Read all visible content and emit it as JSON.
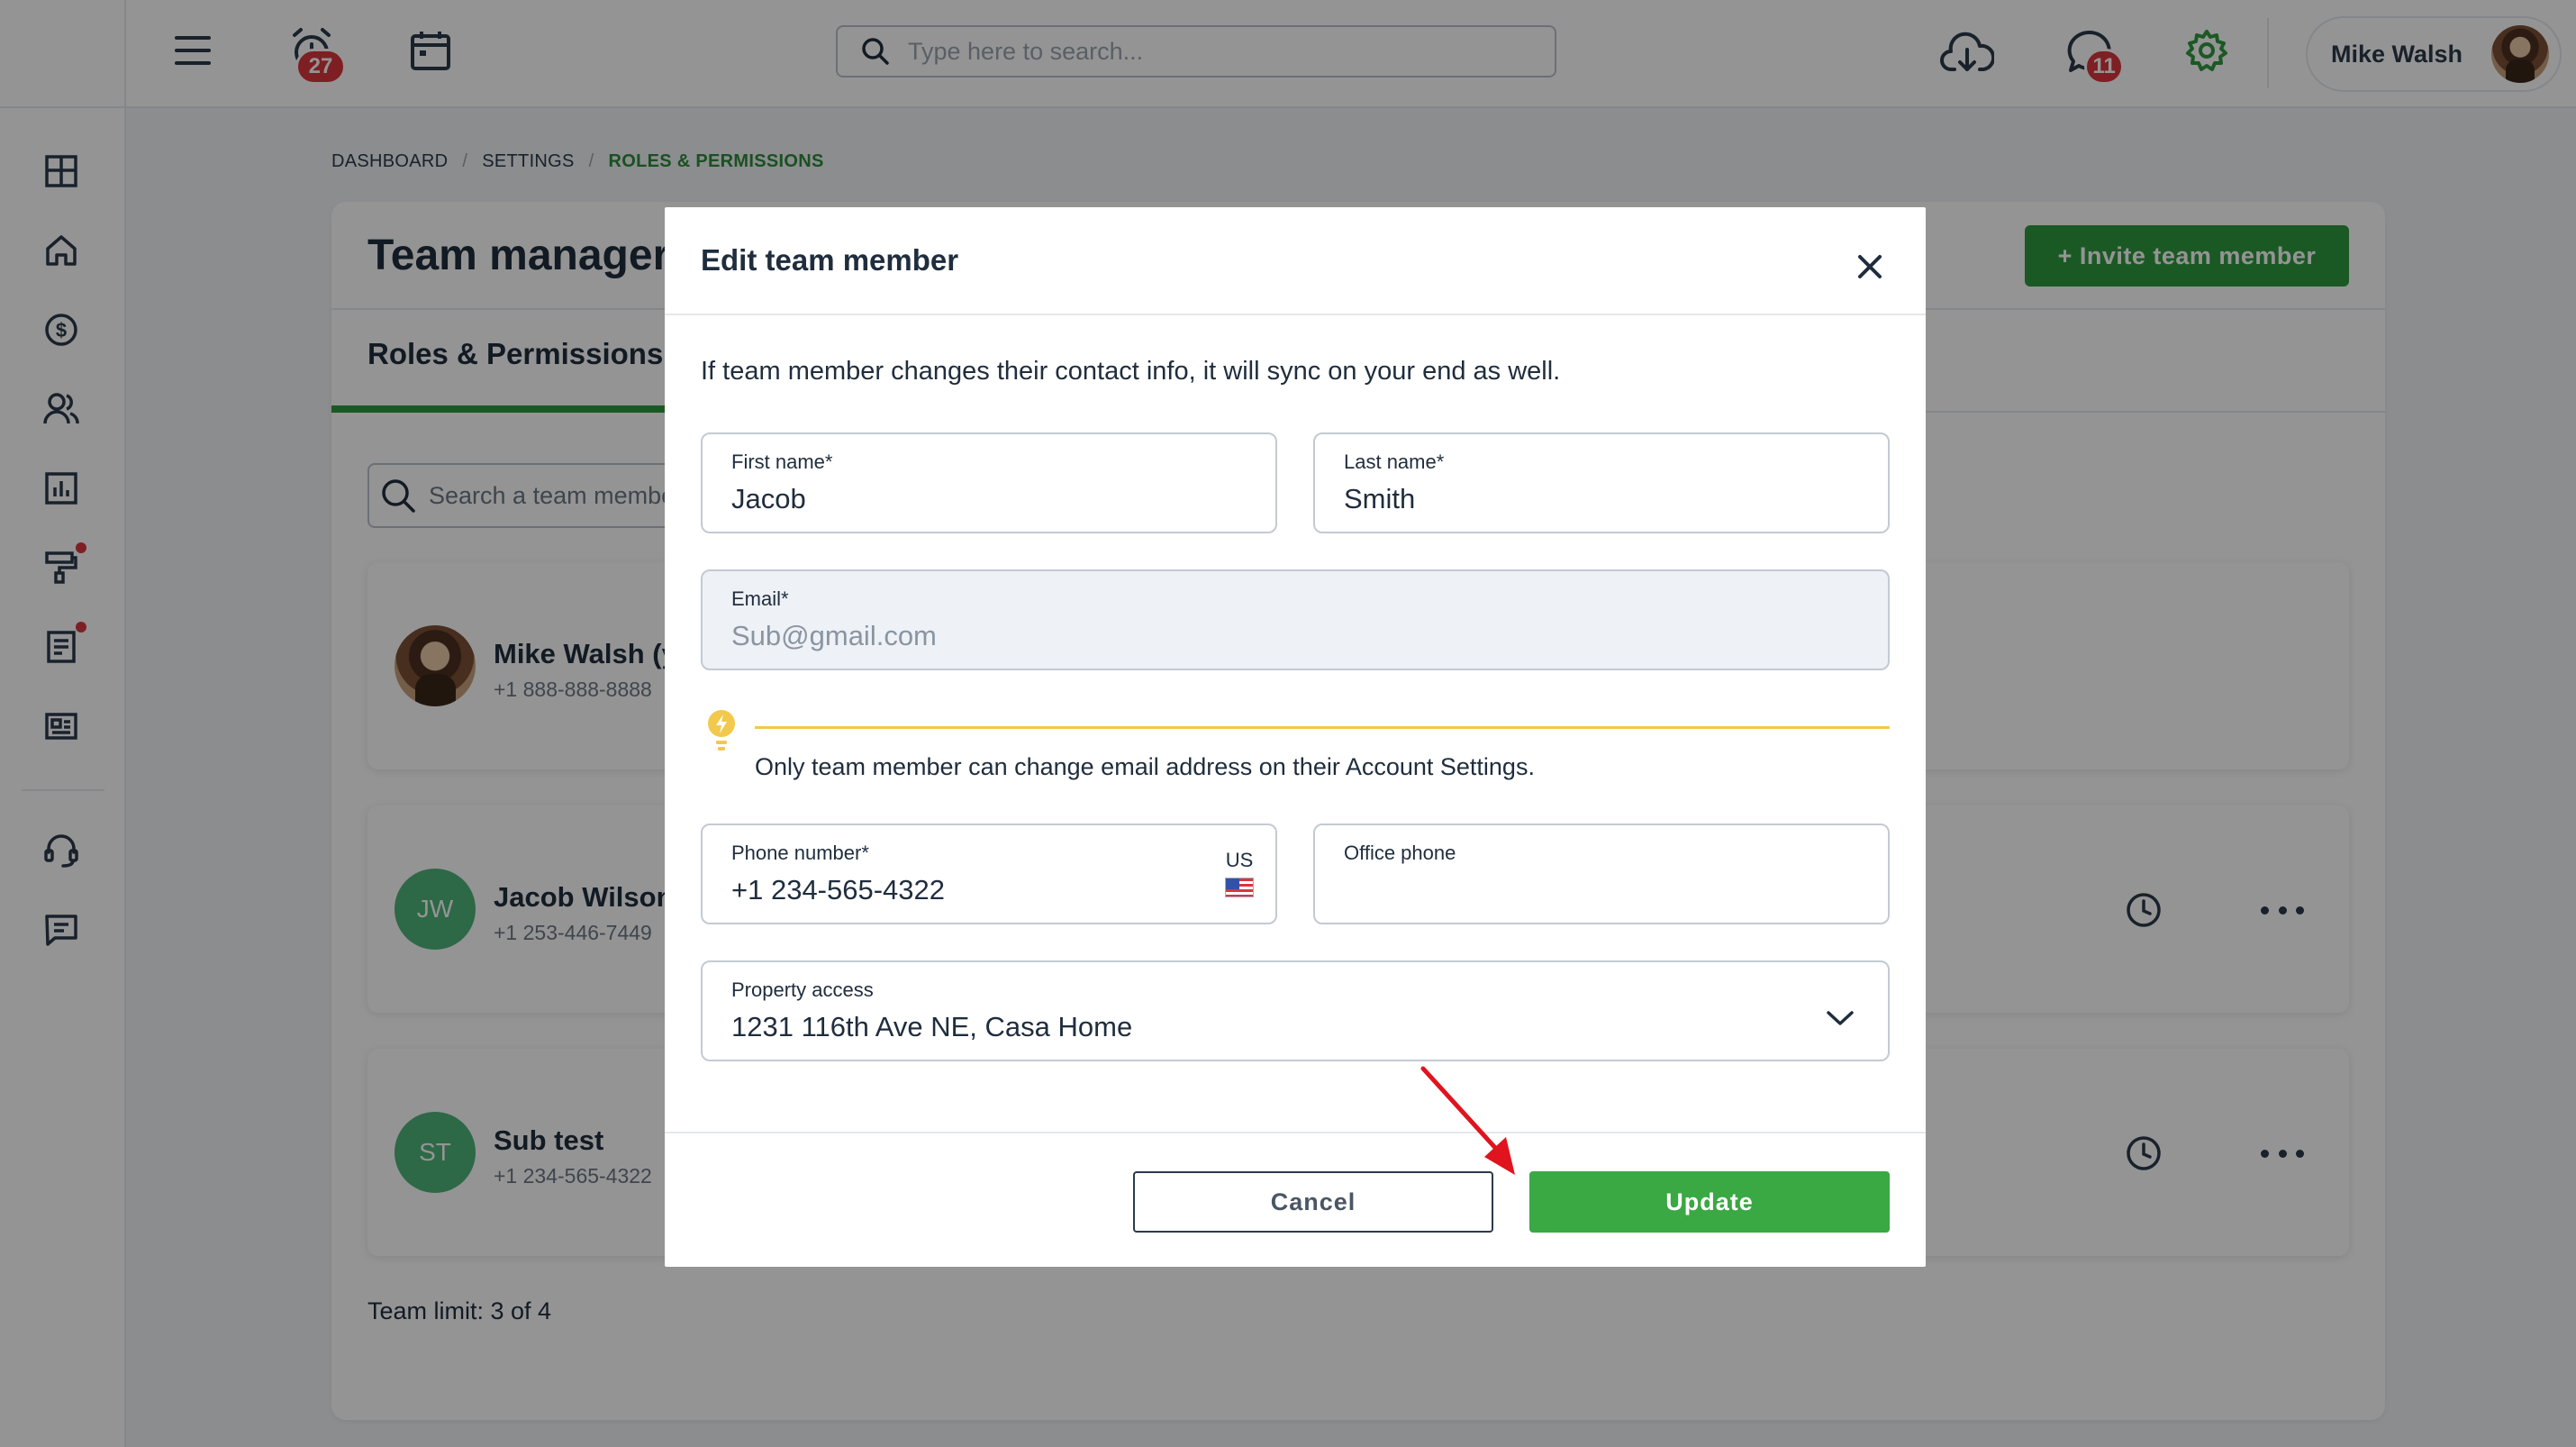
{
  "header": {
    "search_placeholder": "Type here to search...",
    "alarm_badge": "27",
    "chat_badge": "11",
    "user_name": "Mike Walsh"
  },
  "breadcrumb": [
    "DASHBOARD",
    "/",
    "SETTINGS",
    "/",
    "ROLES & PERMISSIONS"
  ],
  "page": {
    "title": "Team manager",
    "invite_label": "+ Invite team member",
    "tab_label": "Roles & Permissions",
    "member_search_placeholder": "Search a team member",
    "team_limit": "Team limit: 3 of 4"
  },
  "members": [
    {
      "name": "Mike Walsh (y",
      "phone": "+1 888-888-8888",
      "initials": ""
    },
    {
      "name": "Jacob Wilson",
      "phone": "+1 253-446-7449",
      "initials": "JW"
    },
    {
      "name": "Sub test",
      "phone": "+1 234-565-4322",
      "initials": "ST"
    }
  ],
  "modal": {
    "title": "Edit team member",
    "note": "If team member changes their contact info, it will sync on your end as well.",
    "first_name_label": "First name*",
    "first_name_value": "Jacob",
    "last_name_label": "Last name*",
    "last_name_value": "Smith",
    "email_label": "Email*",
    "email_value": "Sub@gmail.com",
    "tip_text": "Only team member can change email address on their Account Settings.",
    "phone_label": "Phone number*",
    "phone_value": "+1 234-565-4322",
    "phone_country": "US",
    "office_phone_label": "Office phone",
    "office_phone_value": "",
    "property_label": "Property access",
    "property_value": "1231 116th Ave NE, Casa Home",
    "cancel_label": "Cancel",
    "update_label": "Update"
  },
  "colors": {
    "accent_green": "#2f9a3e",
    "update_green": "#3aa843",
    "badge_red": "#d9363e",
    "tip_yellow": "#f2c94c",
    "annotation_red": "#e0141e"
  },
  "icons": [
    "menu-icon",
    "alarm-icon",
    "calendar-icon",
    "search-icon",
    "cloud-download-icon",
    "chat-icon",
    "gear-icon",
    "dashboard-icon",
    "home-icon",
    "dollar-icon",
    "users-icon",
    "reports-icon",
    "paint-roller-icon",
    "document-icon",
    "card-icon",
    "headset-icon",
    "message-icon",
    "close-icon",
    "lightbulb-icon",
    "chevron-down-icon",
    "clock-icon",
    "more-icon"
  ]
}
